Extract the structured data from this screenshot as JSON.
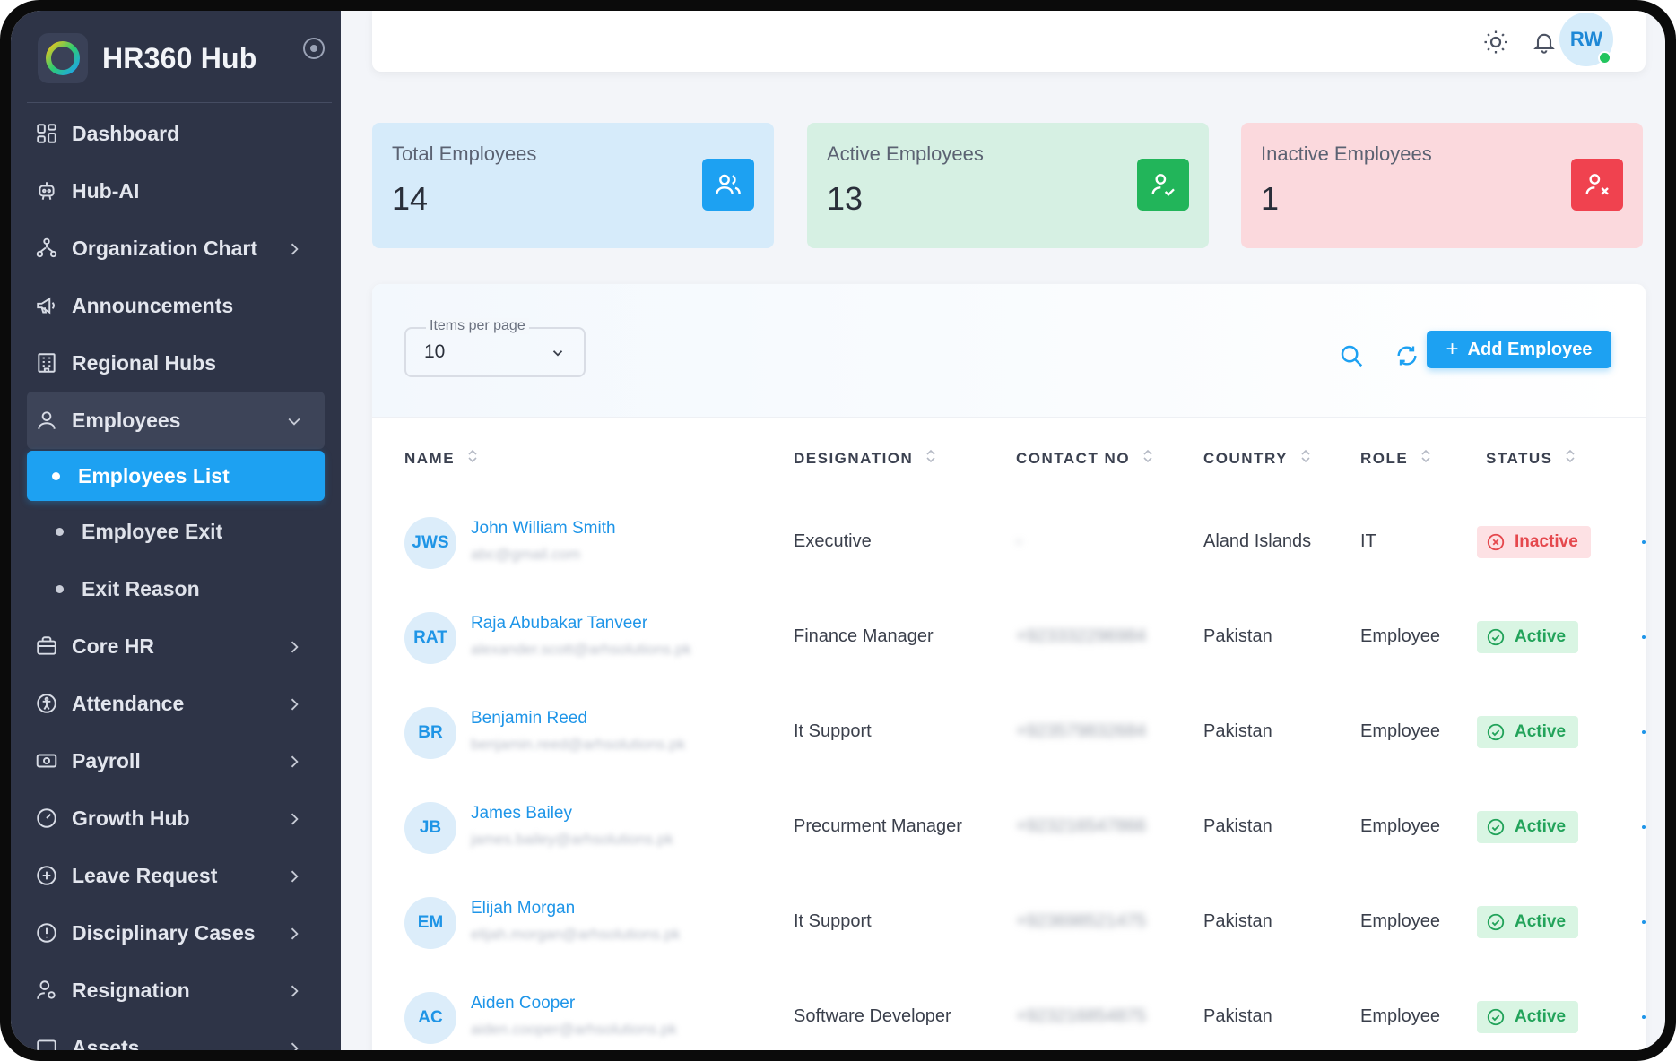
{
  "brand": {
    "title": "HR360 Hub"
  },
  "sidebar": {
    "items": [
      {
        "label": "Dashboard"
      },
      {
        "label": "Hub-AI"
      },
      {
        "label": "Organization Chart"
      },
      {
        "label": "Announcements"
      },
      {
        "label": "Regional Hubs"
      },
      {
        "label": "Employees"
      },
      {
        "label": "Core HR"
      },
      {
        "label": "Attendance"
      },
      {
        "label": "Payroll"
      },
      {
        "label": "Growth Hub"
      },
      {
        "label": "Leave Request"
      },
      {
        "label": "Disciplinary Cases"
      },
      {
        "label": "Resignation"
      },
      {
        "label": "Assets"
      }
    ],
    "employees_sub": [
      {
        "label": "Employees List"
      },
      {
        "label": "Employee Exit"
      },
      {
        "label": "Exit Reason"
      }
    ]
  },
  "topbar": {
    "avatar_initials": "RW"
  },
  "stats": {
    "total": {
      "label": "Total Employees",
      "value": "14"
    },
    "active": {
      "label": "Active Employees",
      "value": "13"
    },
    "inactive": {
      "label": "Inactive Employees",
      "value": "1"
    }
  },
  "toolbar": {
    "items_per_page_label": "Items per page",
    "items_per_page_value": "10",
    "add_button": "Add Employee"
  },
  "table": {
    "columns": [
      "NAME",
      "DESIGNATION",
      "CONTACT NO",
      "COUNTRY",
      "ROLE",
      "STATUS"
    ],
    "rows": [
      {
        "initials": "JWS",
        "name": "John William Smith",
        "email": "abc@gmail.com",
        "designation": "Executive",
        "contact": "-",
        "country": "Aland Islands",
        "role": "IT",
        "status": "Inactive"
      },
      {
        "initials": "RAT",
        "name": "Raja Abubakar Tanveer",
        "email": "alexander.scott@arhsolutions.pk",
        "designation": "Finance Manager",
        "contact": "+923332296984",
        "country": "Pakistan",
        "role": "Employee",
        "status": "Active"
      },
      {
        "initials": "BR",
        "name": "Benjamin Reed",
        "email": "benjamin.reed@arhsolutions.pk",
        "designation": "It Support",
        "contact": "+923579832684",
        "country": "Pakistan",
        "role": "Employee",
        "status": "Active"
      },
      {
        "initials": "JB",
        "name": "James Bailey",
        "email": "james.bailey@arhsolutions.pk",
        "designation": "Precurment Manager",
        "contact": "+923216547866",
        "country": "Pakistan",
        "role": "Employee",
        "status": "Active"
      },
      {
        "initials": "EM",
        "name": "Elijah Morgan",
        "email": "elijah.morgan@arhsolutions.pk",
        "designation": "It Support",
        "contact": "+923698521475",
        "country": "Pakistan",
        "role": "Employee",
        "status": "Active"
      },
      {
        "initials": "AC",
        "name": "Aiden Cooper",
        "email": "aiden.cooper@arhsolutions.pk",
        "designation": "Software Developer",
        "contact": "+923216854875",
        "country": "Pakistan",
        "role": "Employee",
        "status": "Active"
      }
    ]
  },
  "colors": {
    "accent": "#1da1f2",
    "sidebar": "#2e3447",
    "active": "#22a35a",
    "inactive": "#e5484d"
  }
}
